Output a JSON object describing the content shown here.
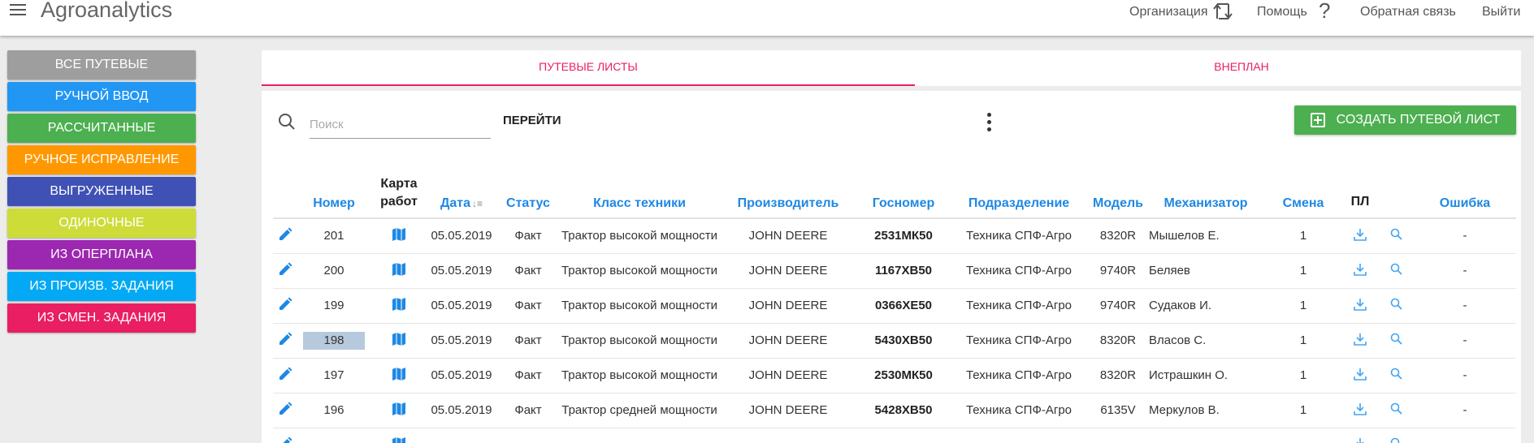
{
  "app": {
    "title": "Agroanalytics"
  },
  "topnav": {
    "organization": "Организация",
    "help": "Помощь",
    "feedback": "Обратная связь",
    "logout": "Выйти"
  },
  "sidebar": {
    "items": [
      {
        "label": "Все путевые",
        "color": "#9e9e9e"
      },
      {
        "label": "Ручной ввод",
        "color": "#2196f3"
      },
      {
        "label": "Рассчитанные",
        "color": "#4caf50"
      },
      {
        "label": "Ручное исправление",
        "color": "#ff9800"
      },
      {
        "label": "Выгруженные",
        "color": "#3f51b5"
      },
      {
        "label": "Одиночные",
        "color": "#cddc39"
      },
      {
        "label": "Из оперплана",
        "color": "#9c27b0"
      },
      {
        "label": "Из произв. задания",
        "color": "#03a9f4"
      },
      {
        "label": "Из смен. задания",
        "color": "#e91e63"
      }
    ]
  },
  "tabs": [
    {
      "label": "Путевые листы",
      "active": true
    },
    {
      "label": "Внеплан",
      "active": false
    }
  ],
  "toolbar": {
    "search_placeholder": "Поиск",
    "go_label": "Перейти",
    "create_label": "Создать путевой лист"
  },
  "table": {
    "headers": {
      "number": "Номер",
      "map_line1": "Карта",
      "map_line2": "работ",
      "date": "Дата",
      "status": "Статус",
      "vehicle_class": "Класс техники",
      "manufacturer": "Производитель",
      "plate": "Госномер",
      "division": "Подразделение",
      "model": "Модель",
      "operator": "Механизатор",
      "shift": "Смена",
      "pl": "ПЛ",
      "error": "Ошибка"
    },
    "rows": [
      {
        "number": "201",
        "date": "05.05.2019",
        "status": "Факт",
        "vehicle_class": "Трактор высокой мощности",
        "manufacturer": "JOHN DEERE",
        "plate": "2531МК50",
        "division": "Техника СПФ-Агро",
        "model": "8320R",
        "operator": "Мышелов Е.",
        "shift": "1",
        "error": "-"
      },
      {
        "number": "200",
        "date": "05.05.2019",
        "status": "Факт",
        "vehicle_class": "Трактор высокой мощности",
        "manufacturer": "JOHN DEERE",
        "plate": "1167ХВ50",
        "division": "Техника СПФ-Агро",
        "model": "9740R",
        "operator": "Беляев",
        "shift": "1",
        "error": "-"
      },
      {
        "number": "199",
        "date": "05.05.2019",
        "status": "Факт",
        "vehicle_class": "Трактор высокой мощности",
        "manufacturer": "JOHN DEERE",
        "plate": "0366ХЕ50",
        "division": "Техника СПФ-Агро",
        "model": "9740R",
        "operator": "Судаков И.",
        "shift": "1",
        "error": "-"
      },
      {
        "number": "198",
        "date": "05.05.2019",
        "status": "Факт",
        "vehicle_class": "Трактор высокой мощности",
        "manufacturer": "JOHN DEERE",
        "plate": "5430ХВ50",
        "division": "Техника СПФ-Агро",
        "model": "8320R",
        "operator": "Власов С.",
        "shift": "1",
        "error": "-"
      },
      {
        "number": "197",
        "date": "05.05.2019",
        "status": "Факт",
        "vehicle_class": "Трактор высокой мощности",
        "manufacturer": "JOHN DEERE",
        "plate": "2530МК50",
        "division": "Техника СПФ-Агро",
        "model": "8320R",
        "operator": "Истрашкин О.",
        "shift": "1",
        "error": "-"
      },
      {
        "number": "196",
        "date": "05.05.2019",
        "status": "Факт",
        "vehicle_class": "Трактор средней мощности",
        "manufacturer": "JOHN DEERE",
        "plate": "5428ХВ50",
        "division": "Техника СПФ-Агро",
        "model": "6135V",
        "operator": "Меркулов В.",
        "shift": "1",
        "error": "-"
      }
    ]
  },
  "colors": {
    "accent_pink": "#e91e63",
    "link_blue": "#1e88e5",
    "create_green": "#4caf50"
  },
  "icons": {
    "edit": "pencil-icon",
    "map": "map-icon",
    "download": "download-icon",
    "view": "magnifier-icon"
  }
}
